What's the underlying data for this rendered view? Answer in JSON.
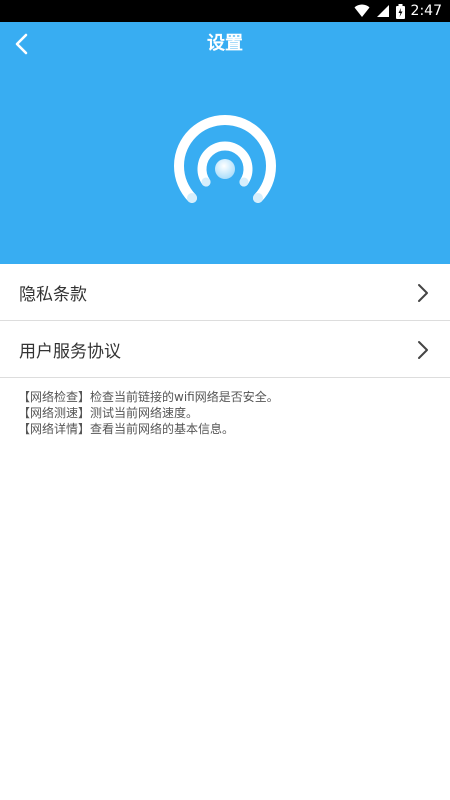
{
  "status_bar": {
    "time": "2:47",
    "icons": [
      "wifi-icon",
      "signal-icon",
      "battery-icon"
    ]
  },
  "header": {
    "title": "设置",
    "back_icon": "chevron-left-icon",
    "logo_icon": "wifi-signal-icon",
    "background_color": "#38adf2"
  },
  "menu": {
    "items": [
      {
        "label": "隐私条款",
        "icon": "chevron-right-icon"
      },
      {
        "label": "用户服务协议",
        "icon": "chevron-right-icon"
      }
    ]
  },
  "info": {
    "lines": [
      "【网络检查】检查当前链接的wifi网络是否安全。",
      "【网络测速】测试当前网络速度。",
      "【网络详情】查看当前网络的基本信息。"
    ]
  }
}
